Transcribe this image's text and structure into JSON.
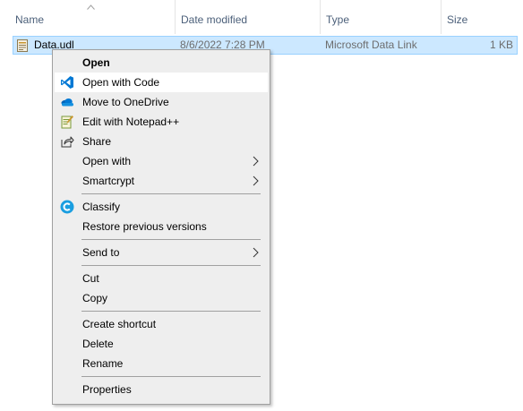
{
  "columns": {
    "name": "Name",
    "date_modified": "Date modified",
    "type": "Type",
    "size": "Size"
  },
  "file": {
    "name": "Data.udl",
    "date_modified": "8/6/2022 7:28 PM",
    "type": "Microsoft Data Link",
    "size": "1 KB",
    "icon": "udl-file-icon"
  },
  "menu": {
    "open": "Open",
    "open_with_code": "Open with Code",
    "move_to_onedrive": "Move to OneDrive",
    "edit_with_notepad": "Edit with Notepad++",
    "share": "Share",
    "open_with": "Open with",
    "smartcrypt": "Smartcrypt",
    "classify": "Classify",
    "restore_previous_versions": "Restore previous versions",
    "send_to": "Send to",
    "cut": "Cut",
    "copy": "Copy",
    "create_shortcut": "Create shortcut",
    "delete": "Delete",
    "rename": "Rename",
    "properties": "Properties"
  },
  "colors": {
    "selection_bg": "#cce8ff",
    "selection_border": "#99d1ff",
    "menu_bg": "#eeeeee",
    "vscode_blue": "#0078d4",
    "onedrive_blue": "#0364b8",
    "classify_blue": "#1a9ee0"
  }
}
